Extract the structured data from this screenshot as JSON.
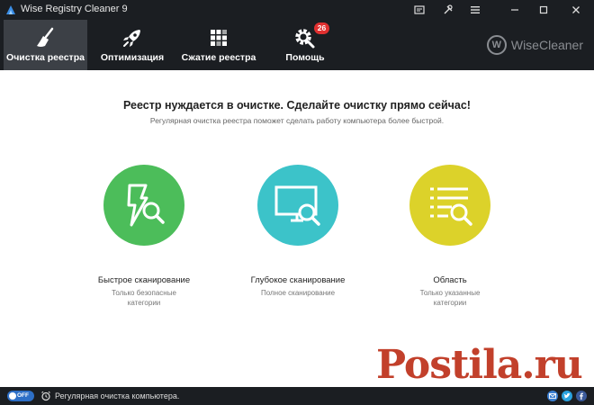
{
  "window": {
    "title": "Wise Registry Cleaner 9"
  },
  "toolbar": {
    "items": [
      {
        "label": "Очистка реестра",
        "icon": "broom-icon",
        "active": true
      },
      {
        "label": "Оптимизация",
        "icon": "rocket-icon",
        "active": false
      },
      {
        "label": "Сжатие реестра",
        "icon": "blocks-icon",
        "active": false
      },
      {
        "label": "Помощь",
        "icon": "gear-wrench-icon",
        "active": false,
        "badge": "26"
      }
    ],
    "brand": "WiseCleaner",
    "brand_logo": "W"
  },
  "main": {
    "title": "Реестр нуждается в очистке. Сделайте очистку прямо сейчас!",
    "subtitle": "Регулярная очистка реестра поможет сделать работу компьютера более быстрой.",
    "cards": [
      {
        "title": "Быстрое сканирование",
        "desc": "Только безопасные категории",
        "color": "#4cbd5a",
        "icon": "bolt-search-icon"
      },
      {
        "title": "Глубокое сканирование",
        "desc": "Полное сканирование",
        "color": "#3cc3c9",
        "icon": "monitor-search-icon"
      },
      {
        "title": "Область",
        "desc": "Только указанные категории",
        "color": "#dcd22a",
        "icon": "list-search-icon"
      }
    ]
  },
  "watermark": {
    "text": "Postila.ru",
    "color": "#c2402b"
  },
  "statusbar": {
    "toggle_label": "OFF",
    "text": "Регулярная очистка компьютера.",
    "social": [
      "mail-icon",
      "twitter-icon",
      "facebook-icon"
    ]
  }
}
